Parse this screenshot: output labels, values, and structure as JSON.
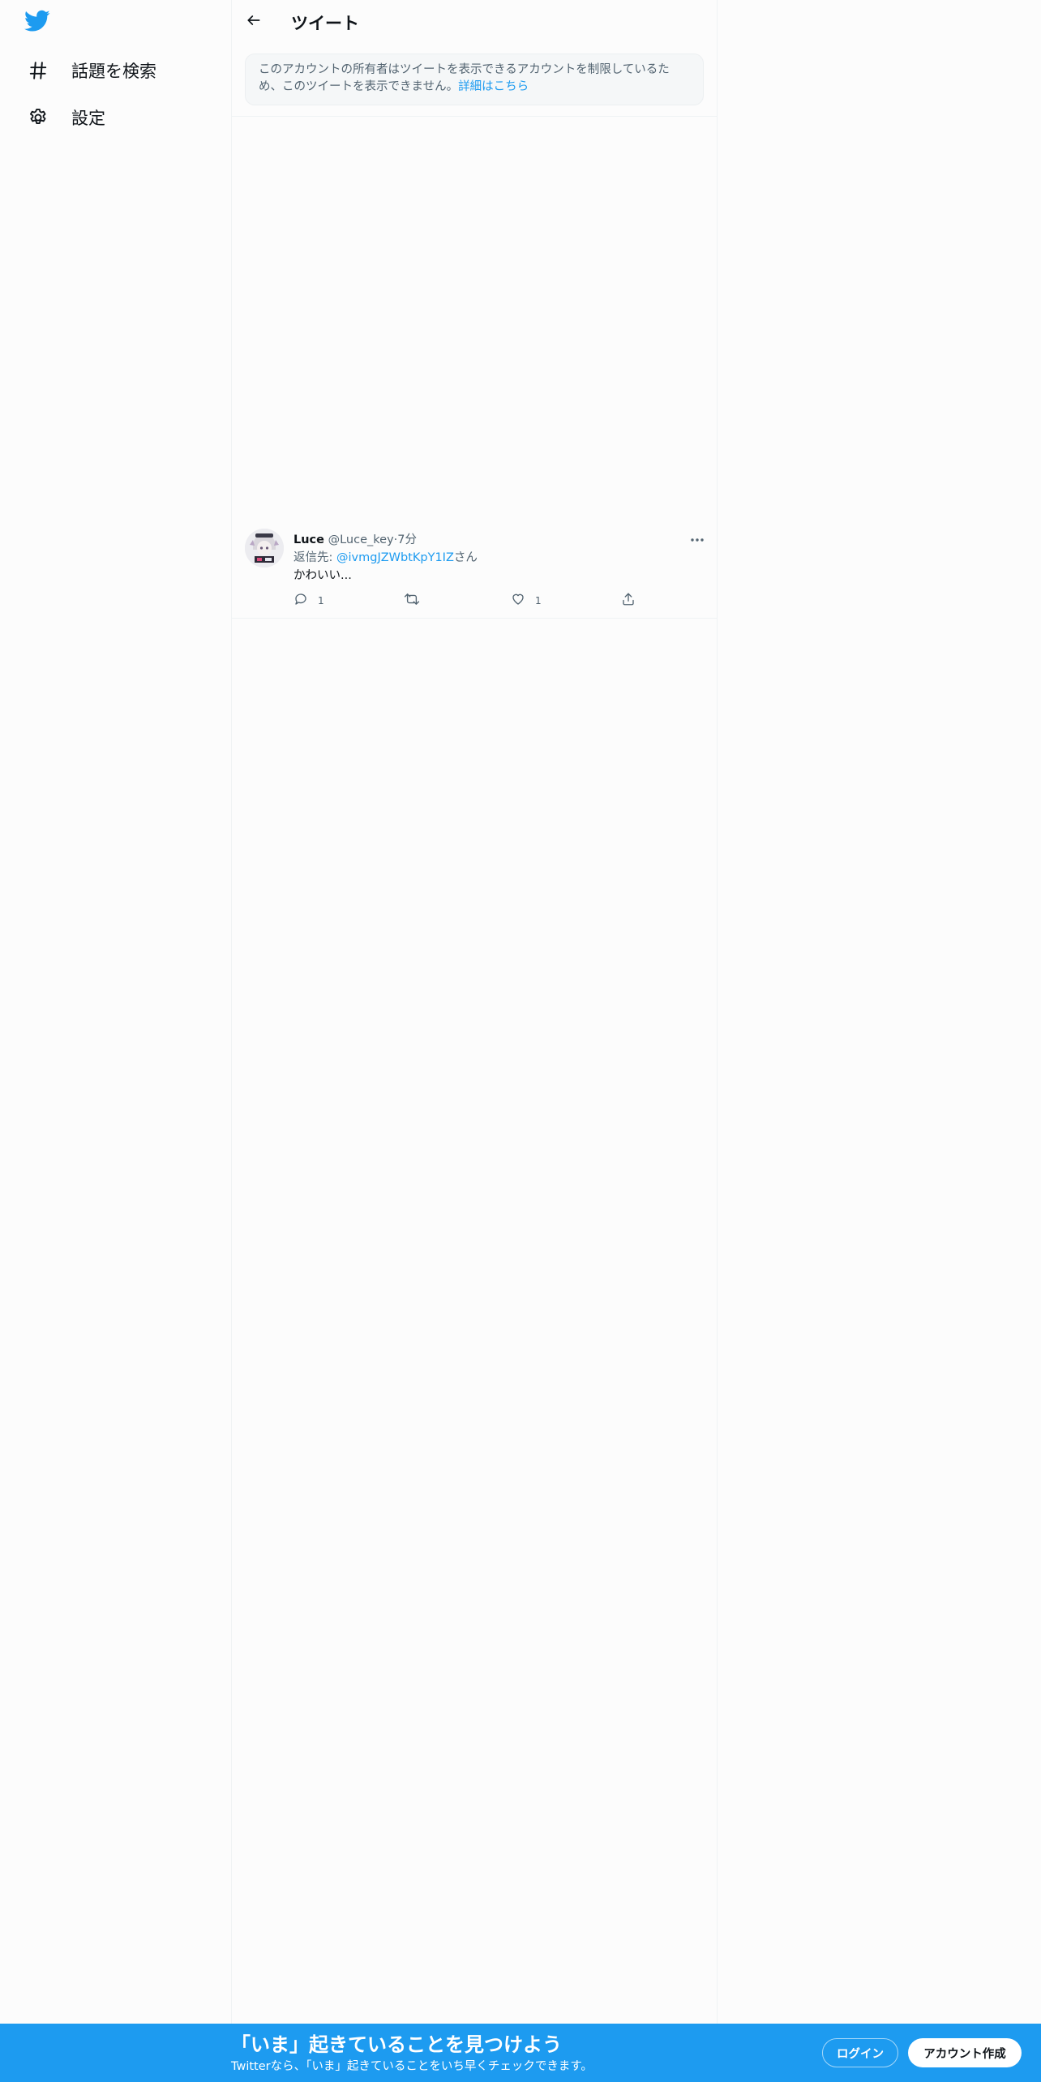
{
  "colors": {
    "brand": "#1d9bf0",
    "text": "#0f1419",
    "secondary_text": "#536471",
    "background": "#fcfcfc"
  },
  "sidebar": {
    "logo_icon": "twitter-bird-icon",
    "items": [
      {
        "icon": "hashtag-icon",
        "label": "話題を検索"
      },
      {
        "icon": "gear-icon",
        "label": "設定"
      }
    ]
  },
  "header": {
    "back_icon": "arrow-left-icon",
    "title": "ツイート"
  },
  "notice": {
    "text": "このアカウントの所有者はツイートを表示できるアカウントを制限しているため、このツイートを表示できません。",
    "link": "詳細はこちら"
  },
  "tweet": {
    "name": "Luce",
    "handle": "@Luce_key",
    "separator": "·",
    "time": "7分",
    "reply_prefix": "返信先: ",
    "reply_mention": "@ivmgJZWbtKpY1IZ",
    "reply_suffix": "さん",
    "text": "かわいい...",
    "actions": {
      "reply_count": "1",
      "retweet_count": "",
      "like_count": "1"
    }
  },
  "bottom_bar": {
    "title": "「いま」起きていることを見つけよう",
    "subtitle": "Twitterなら、「いま」起きていることをいち早くチェックできます。",
    "login_label": "ログイン",
    "signup_label": "アカウント作成"
  }
}
